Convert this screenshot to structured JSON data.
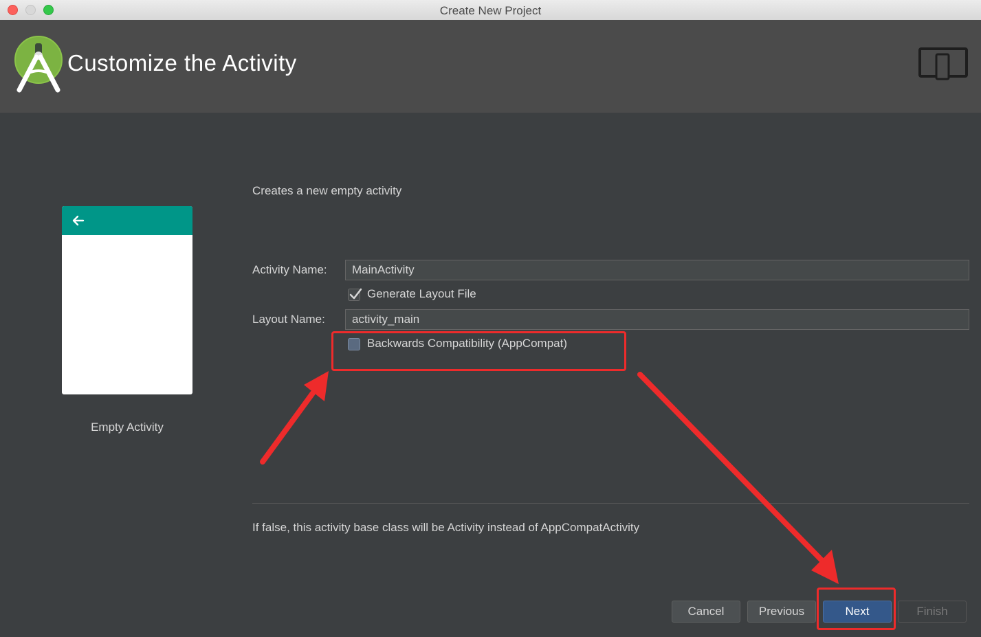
{
  "window": {
    "title": "Create New Project"
  },
  "header": {
    "title": "Customize the Activity"
  },
  "template": {
    "name": "Empty Activity"
  },
  "form": {
    "description": "Creates a new empty activity",
    "activity_name": {
      "label": "Activity Name:",
      "value": "MainActivity"
    },
    "generate_layout": {
      "label": "Generate Layout File",
      "checked": true
    },
    "layout_name": {
      "label": "Layout Name:",
      "value": "activity_main"
    },
    "backwards_compat": {
      "label": "Backwards Compatibility (AppCompat)",
      "checked": false
    },
    "hint": "If false, this activity base class will be Activity instead of AppCompatActivity"
  },
  "buttons": {
    "cancel": "Cancel",
    "previous": "Previous",
    "next": "Next",
    "finish": "Finish"
  },
  "colors": {
    "background": "#3c3f41",
    "header": "#4b4b4b",
    "preview_bar": "#009688",
    "primary_button": "#34588a",
    "annotation": "#ee2b2b"
  }
}
